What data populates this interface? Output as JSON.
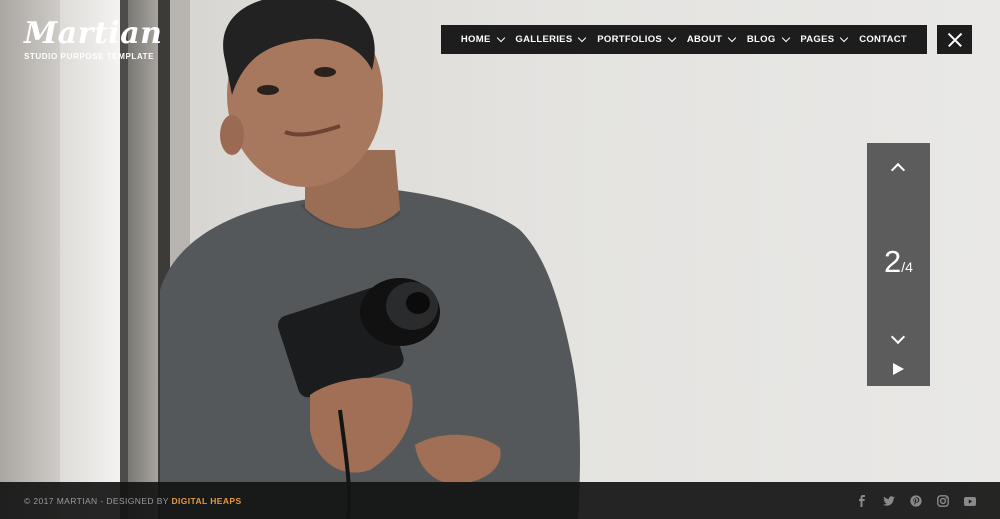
{
  "logo": {
    "title": "Martian",
    "subtitle": "STUDIO PURPOSE TEMPLATE"
  },
  "nav": {
    "items": [
      {
        "label": "HOME",
        "dropdown": true
      },
      {
        "label": "GALLERIES",
        "dropdown": true
      },
      {
        "label": "PORTFOLIOS",
        "dropdown": true
      },
      {
        "label": "ABOUT",
        "dropdown": true
      },
      {
        "label": "BLOG",
        "dropdown": true
      },
      {
        "label": "PAGES",
        "dropdown": true
      },
      {
        "label": "CONTACT",
        "dropdown": false
      }
    ],
    "close_icon": "close-icon"
  },
  "slider": {
    "current": "2",
    "separator": "/",
    "total": "4",
    "up_icon": "chevron-up-icon",
    "down_icon": "chevron-down-icon",
    "play_icon": "play-icon"
  },
  "footer": {
    "copyright": "© 2017 MARTIAN - DESIGNED BY ",
    "designer": "DIGITAL HEAPS",
    "social": [
      "facebook-icon",
      "twitter-icon",
      "pinterest-icon",
      "instagram-icon",
      "youtube-icon"
    ]
  },
  "colors": {
    "accent": "#e8973a",
    "nav_bg": "#1d1d1d",
    "slider_bg": "#505050"
  }
}
